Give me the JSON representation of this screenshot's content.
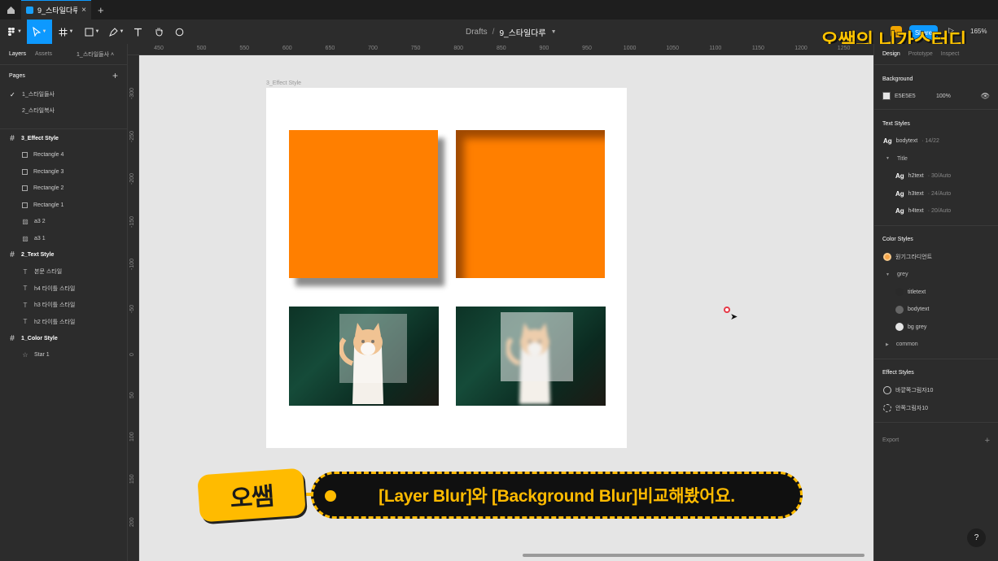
{
  "tabbar": {
    "file_tab_title": "9_스타일다루",
    "close_glyph": "×",
    "add_glyph": "+"
  },
  "toolbar": {
    "crumb_parent": "Drafts",
    "crumb_separator": "/",
    "crumb_file": "9_스타일다루",
    "share_label": "Share",
    "zoom_label": "165%",
    "brand_title": "오쌤의 니가스터디"
  },
  "left_panel": {
    "tab_layers": "Layers",
    "tab_assets": "Assets",
    "current_page": "1_스타일들사",
    "pages_heading": "Pages",
    "pages": [
      {
        "name": "1_스타일들사",
        "selected": true
      },
      {
        "name": "2_스타일복사",
        "selected": false
      }
    ],
    "layers": [
      {
        "name": "3_Effect Style",
        "kind": "frame"
      },
      {
        "name": "Rectangle 4",
        "kind": "rect"
      },
      {
        "name": "Rectangle 3",
        "kind": "rect"
      },
      {
        "name": "Rectangle 2",
        "kind": "rect"
      },
      {
        "name": "Rectangle 1",
        "kind": "rect"
      },
      {
        "name": "a3 2",
        "kind": "image"
      },
      {
        "name": "a3 1",
        "kind": "image"
      },
      {
        "name": "2_Text Style",
        "kind": "frame"
      },
      {
        "name": "본문 스타일",
        "kind": "text"
      },
      {
        "name": "h4 타이틀 스타일",
        "kind": "text"
      },
      {
        "name": "h3 타이틀 스타일",
        "kind": "text"
      },
      {
        "name": "h2 타이틀 스타일",
        "kind": "text"
      },
      {
        "name": "1_Color Style",
        "kind": "frame"
      },
      {
        "name": "Star 1",
        "kind": "star"
      }
    ]
  },
  "canvas": {
    "ruler_top": [
      "450",
      "500",
      "550",
      "600",
      "650",
      "700",
      "750",
      "800",
      "850",
      "900",
      "950",
      "1000",
      "1050",
      "1100",
      "1150",
      "1200",
      "1250"
    ],
    "ruler_left": [
      "-300",
      "-250",
      "-200",
      "-150",
      "-100",
      "-50",
      "0",
      "50",
      "100",
      "150",
      "200"
    ],
    "frame_label": "3_Effect Style"
  },
  "caption": {
    "tag": "오쌤",
    "text": "[Layer Blur]와 [Background Blur]비교해봤어요."
  },
  "right_panel": {
    "tabs": [
      "Design",
      "Prototype",
      "Inspect"
    ],
    "background_title": "Background",
    "background_hex": "E5E5E5",
    "background_opacity": "100%",
    "text_styles_title": "Text Styles",
    "text_styles": {
      "body": {
        "name": "bodytext",
        "meta": "· 14/22"
      },
      "group": "Title",
      "items": [
        {
          "name": "h2text",
          "meta": "· 30/Auto"
        },
        {
          "name": "h3text",
          "meta": "· 24/Auto"
        },
        {
          "name": "h4text",
          "meta": "· 20/Auto"
        }
      ]
    },
    "color_styles_title": "Color Styles",
    "color_styles": {
      "top": {
        "name": "원기그라디언트",
        "color": "#f5a54a"
      },
      "group": "grey",
      "items": [
        {
          "name": "titletext",
          "color": "#2a2a2a"
        },
        {
          "name": "bodytext",
          "color": "#666666"
        },
        {
          "name": "bg grey",
          "color": "#e5e5e5"
        }
      ],
      "group2": "common"
    },
    "effect_styles_title": "Effect Styles",
    "effect_styles": [
      "바깥쪽그림자10",
      "안쪽그림자10"
    ],
    "export_title": "Export"
  },
  "help": {
    "label": "?"
  },
  "colors": {
    "accent_blue": "#0d99ff",
    "shape_orange": "#ff7f00",
    "caption_yellow": "#ffbb00",
    "canvas_bg": "#e5e5e5"
  }
}
